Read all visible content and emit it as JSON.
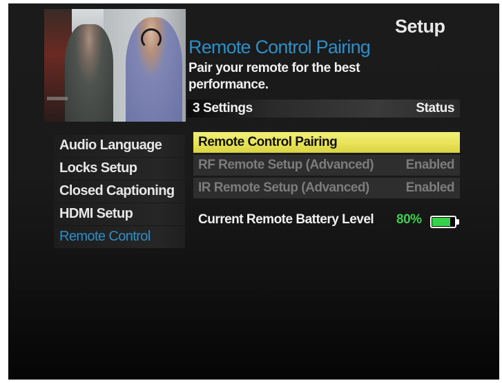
{
  "screen_title": "Setup",
  "heading": "Remote Control Pairing",
  "description": "Pair your remote for the best performance.",
  "settings_bar": {
    "count": "3 Settings",
    "status_header": "Status"
  },
  "menu": {
    "items": [
      {
        "label": "Audio Language"
      },
      {
        "label": "Locks Setup"
      },
      {
        "label": "Closed Captioning"
      },
      {
        "label": "HDMI Setup"
      },
      {
        "label": "Remote Control",
        "active": true
      }
    ]
  },
  "options": [
    {
      "label": "Remote Control Pairing",
      "status": "",
      "selected": true
    },
    {
      "label": "RF Remote Setup (Advanced)",
      "status": "Enabled"
    },
    {
      "label": "IR Remote Setup (Advanced)",
      "status": "Enabled"
    }
  ],
  "battery": {
    "label": "Current Remote Battery Level",
    "percent_text": "80%",
    "level": 0.8
  },
  "colors": {
    "accent_blue": "#2d8fc8",
    "highlight_yellow": "#e7e258",
    "battery_green": "#35d14a"
  }
}
